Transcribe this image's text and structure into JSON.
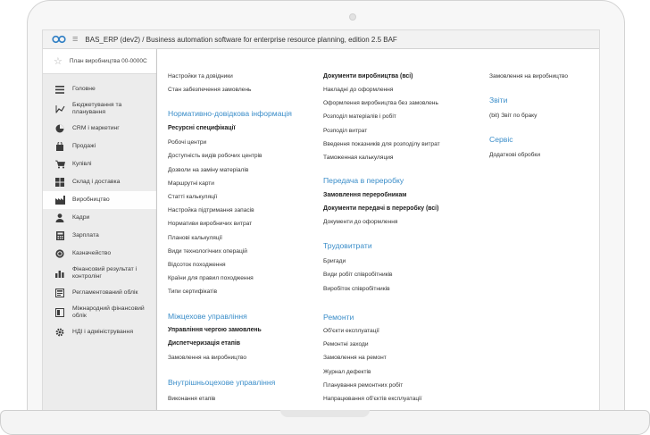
{
  "window": {
    "title": "BAS_ERP (dev2) / Business automation software for enterprise resource planning, edition 2.5 BAF"
  },
  "open_tab": {
    "label": "План виробництва 00-0000С"
  },
  "sidebar": {
    "items": [
      {
        "label": "Головне",
        "icon": "menu-lines-icon"
      },
      {
        "label": "Бюджетування та планування",
        "icon": "trend-icon"
      },
      {
        "label": "CRM і маркетинг",
        "icon": "pie-icon"
      },
      {
        "label": "Продажі",
        "icon": "bag-icon"
      },
      {
        "label": "Купівлі",
        "icon": "cart-icon"
      },
      {
        "label": "Склад і доставка",
        "icon": "warehouse-icon"
      },
      {
        "label": "Виробництво",
        "icon": "factory-icon"
      },
      {
        "label": "Кадри",
        "icon": "person-icon"
      },
      {
        "label": "Зарплата",
        "icon": "calculator-icon"
      },
      {
        "label": "Казначейство",
        "icon": "coin-icon"
      },
      {
        "label": "Фінансовий результат і контролінг",
        "icon": "bar-chart-icon"
      },
      {
        "label": "Регламентований облік",
        "icon": "ledger-icon"
      },
      {
        "label": "Міжнародний фінансовий облік",
        "icon": "book-icon"
      },
      {
        "label": "НДІ і адміністрування",
        "icon": "gear-icon"
      }
    ]
  },
  "col1": {
    "top_links": [
      "Настройки та довідники",
      "Стан забезпечення замовлень"
    ],
    "groups": [
      {
        "title": "Нормативно-довідкова інформація",
        "links": [
          {
            "label": "Ресурсні специфікації",
            "bold": true
          },
          {
            "label": "Робочі центри"
          },
          {
            "label": "Доступність видів робочих центрів"
          },
          {
            "label": "Дозволи на заміну матеріалів"
          },
          {
            "label": "Маршрутні карти"
          },
          {
            "label": "Статті калькуляції"
          },
          {
            "label": "Настройка підтримання запасів"
          },
          {
            "label": "Нормативи виробничих витрат"
          },
          {
            "label": "Планові калькуляції"
          },
          {
            "label": "Види технологічних операцій"
          },
          {
            "label": "Відсоток походження"
          },
          {
            "label": "Країни для правил походження"
          },
          {
            "label": "Типи сертифікатів"
          }
        ]
      },
      {
        "title": "Міжцехове управління",
        "links": [
          {
            "label": "Управління чергою замовлень",
            "bold": true
          },
          {
            "label": "Диспетчеризація етапів",
            "bold": true
          },
          {
            "label": "Замовлення на виробництво"
          }
        ]
      },
      {
        "title": "Внутрішньоцехове управління",
        "links": [
          {
            "label": "Виконання етапів"
          }
        ]
      }
    ]
  },
  "col2": {
    "top_links": [
      {
        "label": "Документи виробництва (всі)",
        "bold": true
      },
      {
        "label": "Накладні до оформлення"
      },
      {
        "label": "Оформлення виробництва без замовлень"
      },
      {
        "label": "Розподіл матеріалів і робіт"
      },
      {
        "label": "Розподіл витрат"
      },
      {
        "label": "Введення показників для розподілу витрат"
      },
      {
        "label": "Таможенная калькуляция"
      }
    ],
    "groups": [
      {
        "title": "Передача в переробку",
        "links": [
          {
            "label": "Замовлення переробникам",
            "bold": true
          },
          {
            "label": "Документи передачі в переробку (всі)",
            "bold": true
          },
          {
            "label": "Документи до оформлення"
          }
        ]
      },
      {
        "title": "Трудовитрати",
        "links": [
          {
            "label": "Бригади"
          },
          {
            "label": "Види робіт співробітників"
          },
          {
            "label": "Виробіток співробітників"
          }
        ]
      },
      {
        "title": "Ремонти",
        "links": [
          {
            "label": "Об'єкти експлуатації"
          },
          {
            "label": "Ремонтні заходи"
          },
          {
            "label": "Замовлення на ремонт"
          },
          {
            "label": "Журнал дефектів"
          },
          {
            "label": "Планування ремонтних робіт"
          },
          {
            "label": "Напрацювання об'єктів експлуатації"
          }
        ]
      }
    ]
  },
  "col3": {
    "top_links": [
      "Замовлення на виробництво"
    ],
    "groups": [
      {
        "title": "Звіти",
        "links": [
          {
            "label": "(bit) Звіт по браку"
          }
        ]
      },
      {
        "title": "Сервіс",
        "links": [
          {
            "label": "Додаткові обробки"
          }
        ]
      }
    ]
  },
  "colors": {
    "group_title": "#3a8dc9",
    "sidebar_bg": "#ececec",
    "logo": "#2e7ec4"
  }
}
